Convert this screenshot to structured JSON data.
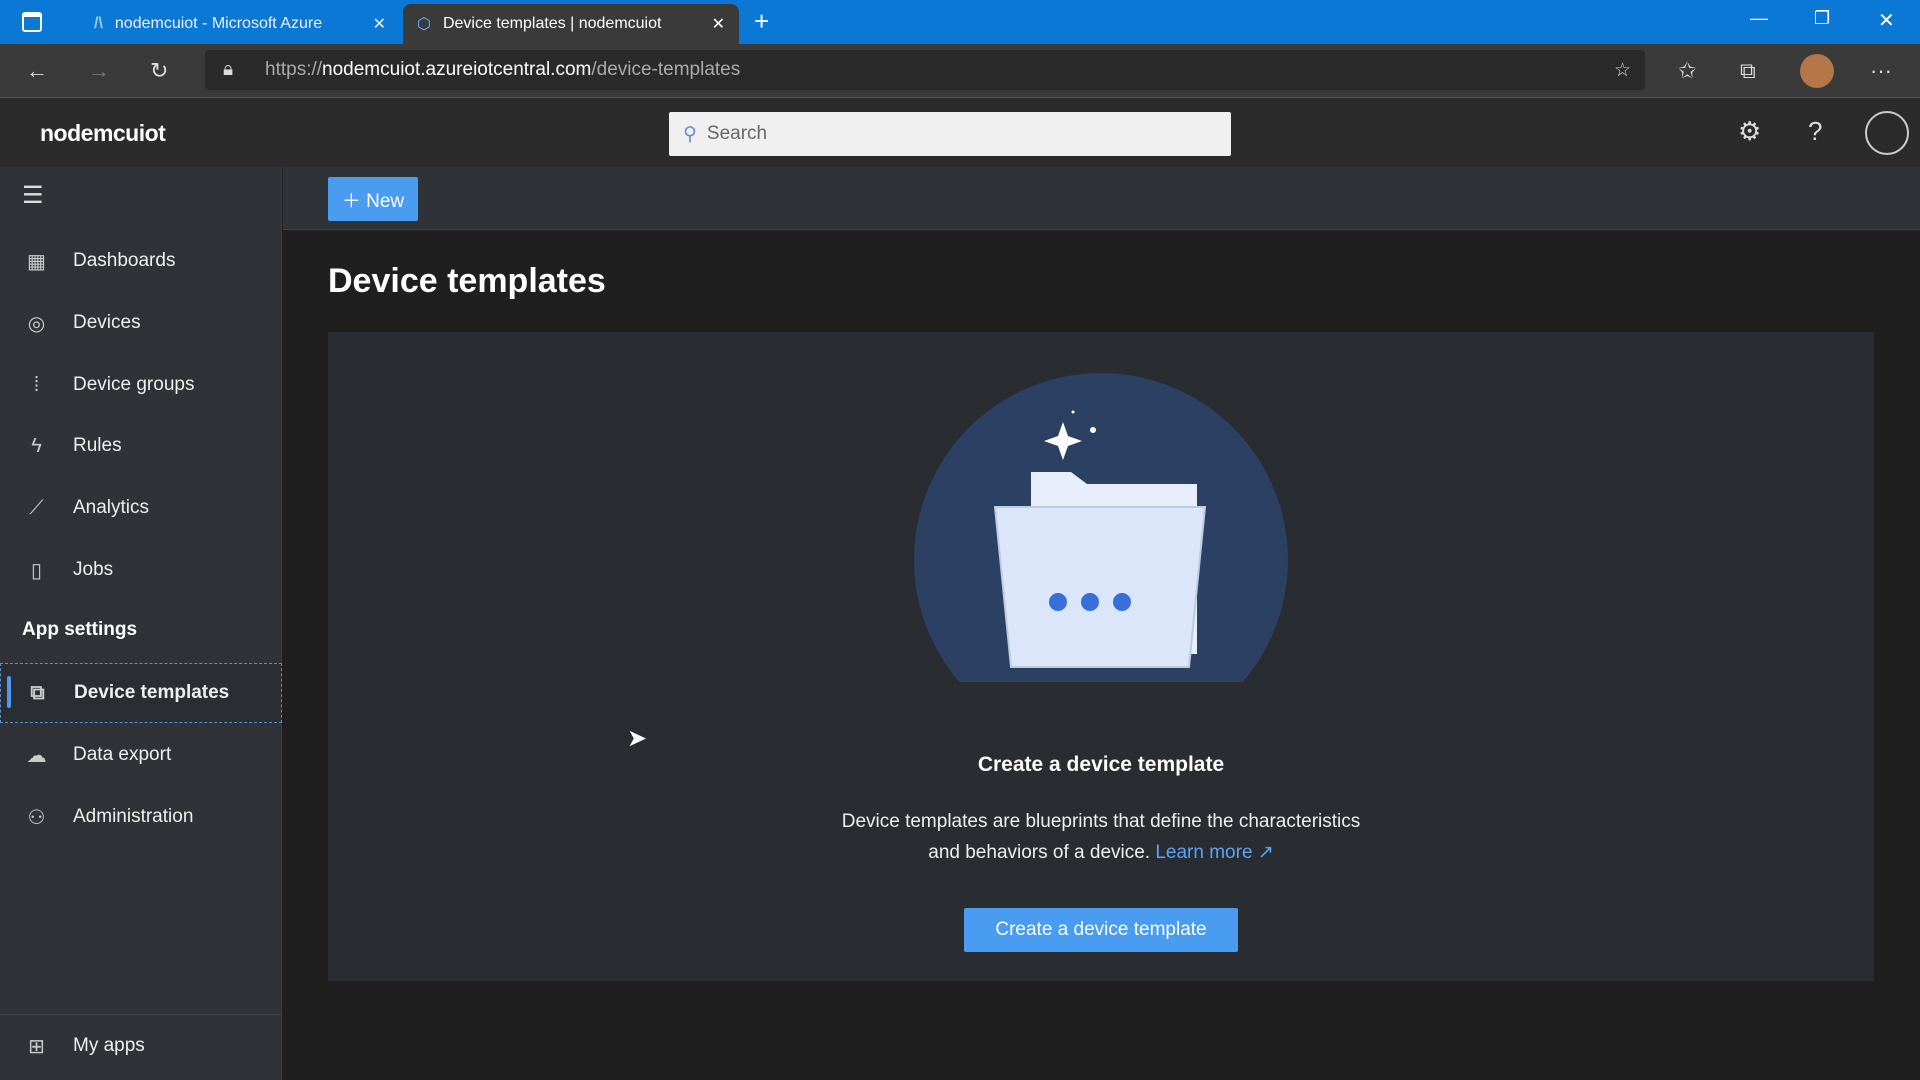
{
  "browser": {
    "tabs": [
      {
        "title": "nodemcuiot - Microsoft Azure"
      },
      {
        "title": "Device templates | nodemcuiot"
      }
    ],
    "url_prefix": "https://",
    "url_host": "nodemcuiot.azureiotcentral.com",
    "url_path": "/device-templates"
  },
  "app": {
    "name": "nodemcuiot",
    "search_placeholder": "Search"
  },
  "sidebar": {
    "items": [
      {
        "label": "Dashboards"
      },
      {
        "label": "Devices"
      },
      {
        "label": "Device groups"
      },
      {
        "label": "Rules"
      },
      {
        "label": "Analytics"
      },
      {
        "label": "Jobs"
      }
    ],
    "section": "App settings",
    "settings_items": [
      {
        "label": "Device templates"
      },
      {
        "label": "Data export"
      },
      {
        "label": "Administration"
      }
    ],
    "bottom": "My apps"
  },
  "toolbar": {
    "new_label": "New"
  },
  "main": {
    "title": "Device templates",
    "empty_heading": "Create a device template",
    "desc1": "Device templates are blueprints that define the characteristics",
    "desc2": "and behaviors of a device.",
    "learn_more": "Learn more",
    "create_button": "Create a device template"
  }
}
